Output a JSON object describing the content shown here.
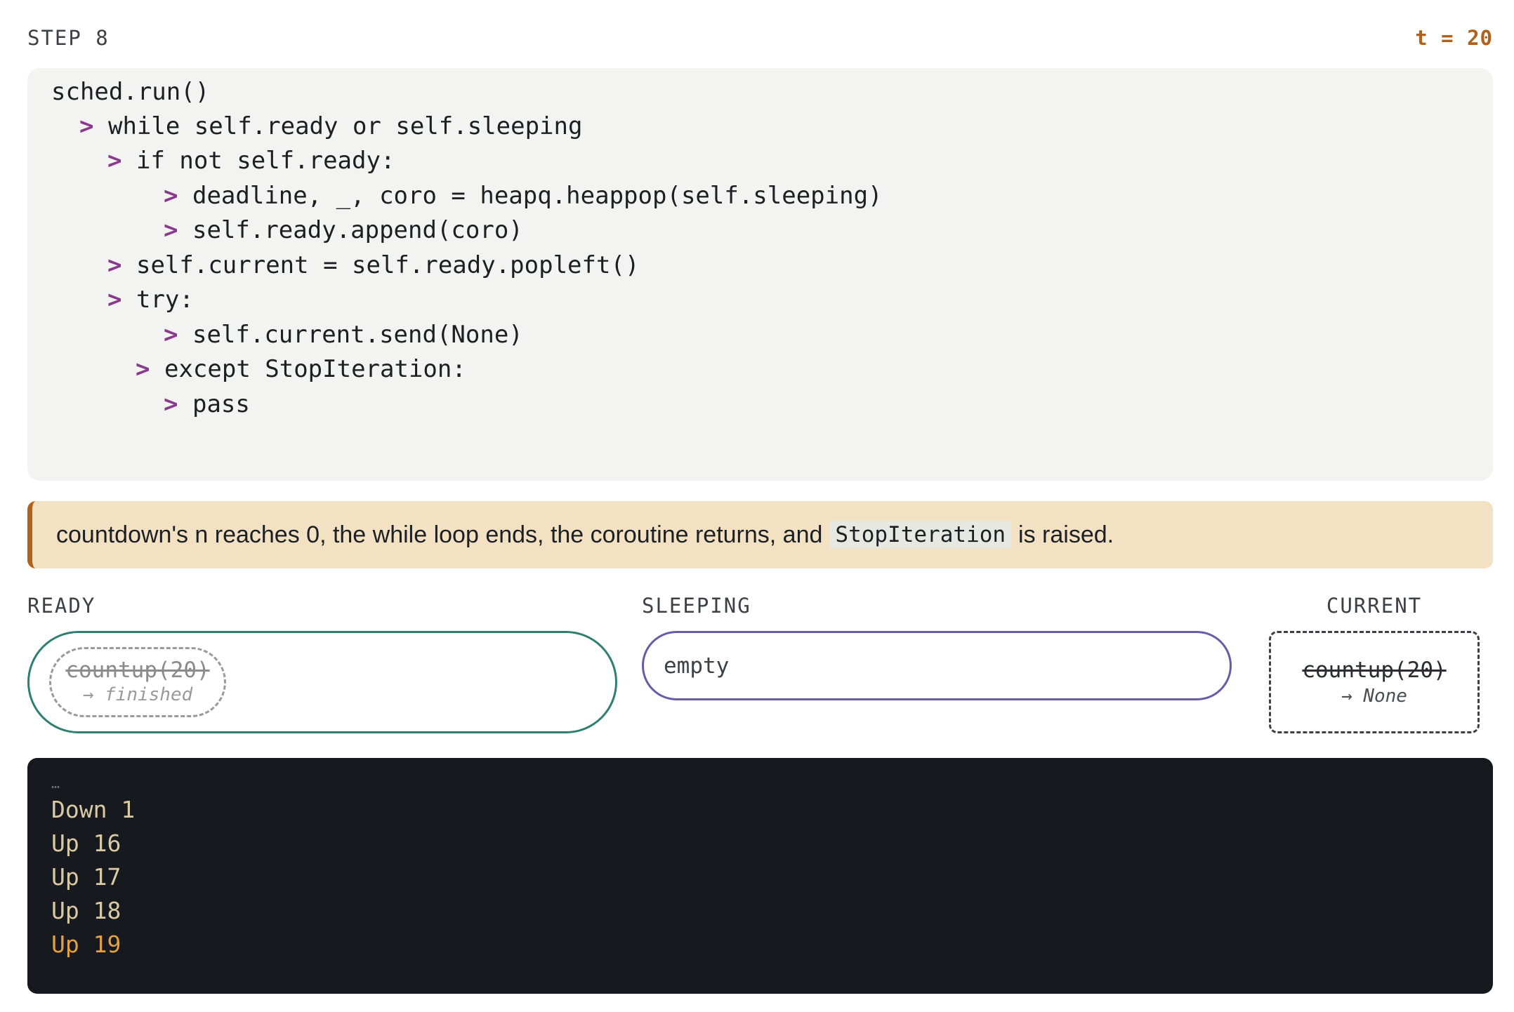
{
  "header": {
    "step": "STEP 8",
    "time": "t = 20"
  },
  "code": {
    "caret": ">",
    "lines": [
      {
        "text": "sched.run()",
        "caret": false
      },
      {
        "text": "while self.ready or self.sleeping",
        "caret": true
      },
      {
        "text": "if not self.ready:",
        "caret": true
      },
      {
        "text": "deadline, _, coro = heapq.heappop(self.sleeping)",
        "caret": true
      },
      {
        "text": "self.ready.append(coro)",
        "caret": true
      },
      {
        "text": "self.current = self.ready.popleft()",
        "caret": true
      },
      {
        "text": "try:",
        "caret": true
      },
      {
        "text": "self.current.send(None)",
        "caret": true
      },
      {
        "text": "except StopIteration:",
        "caret": true
      },
      {
        "text": "pass",
        "caret": true
      }
    ]
  },
  "note": {
    "before": "countdown's n reaches 0, the while loop ends, the coroutine returns, and",
    "code": "StopIteration",
    "after": "is raised."
  },
  "queues": {
    "ready": {
      "label": "READY",
      "item_name": "countup(20)",
      "item_status": "→ finished"
    },
    "sleeping": {
      "label": "SLEEPING",
      "empty_text": "empty"
    },
    "current": {
      "label": "CURRENT",
      "name": "countup(20)",
      "status": "→ None"
    }
  },
  "console": {
    "ellipsis": "…",
    "lines": [
      "Down 1",
      "Up 16",
      "Up 17",
      "Up 18",
      "Up 19"
    ]
  },
  "colors": {
    "accent": "#b0621c",
    "caret": "#8a3a8c",
    "ready_border": "#2e7f72",
    "sleeping_border": "#6a5ba8",
    "console_bg": "#161a1e",
    "console_text": "#d9c9a4",
    "console_latest": "#e3a13f",
    "note_bg": "#f3e1c3"
  }
}
